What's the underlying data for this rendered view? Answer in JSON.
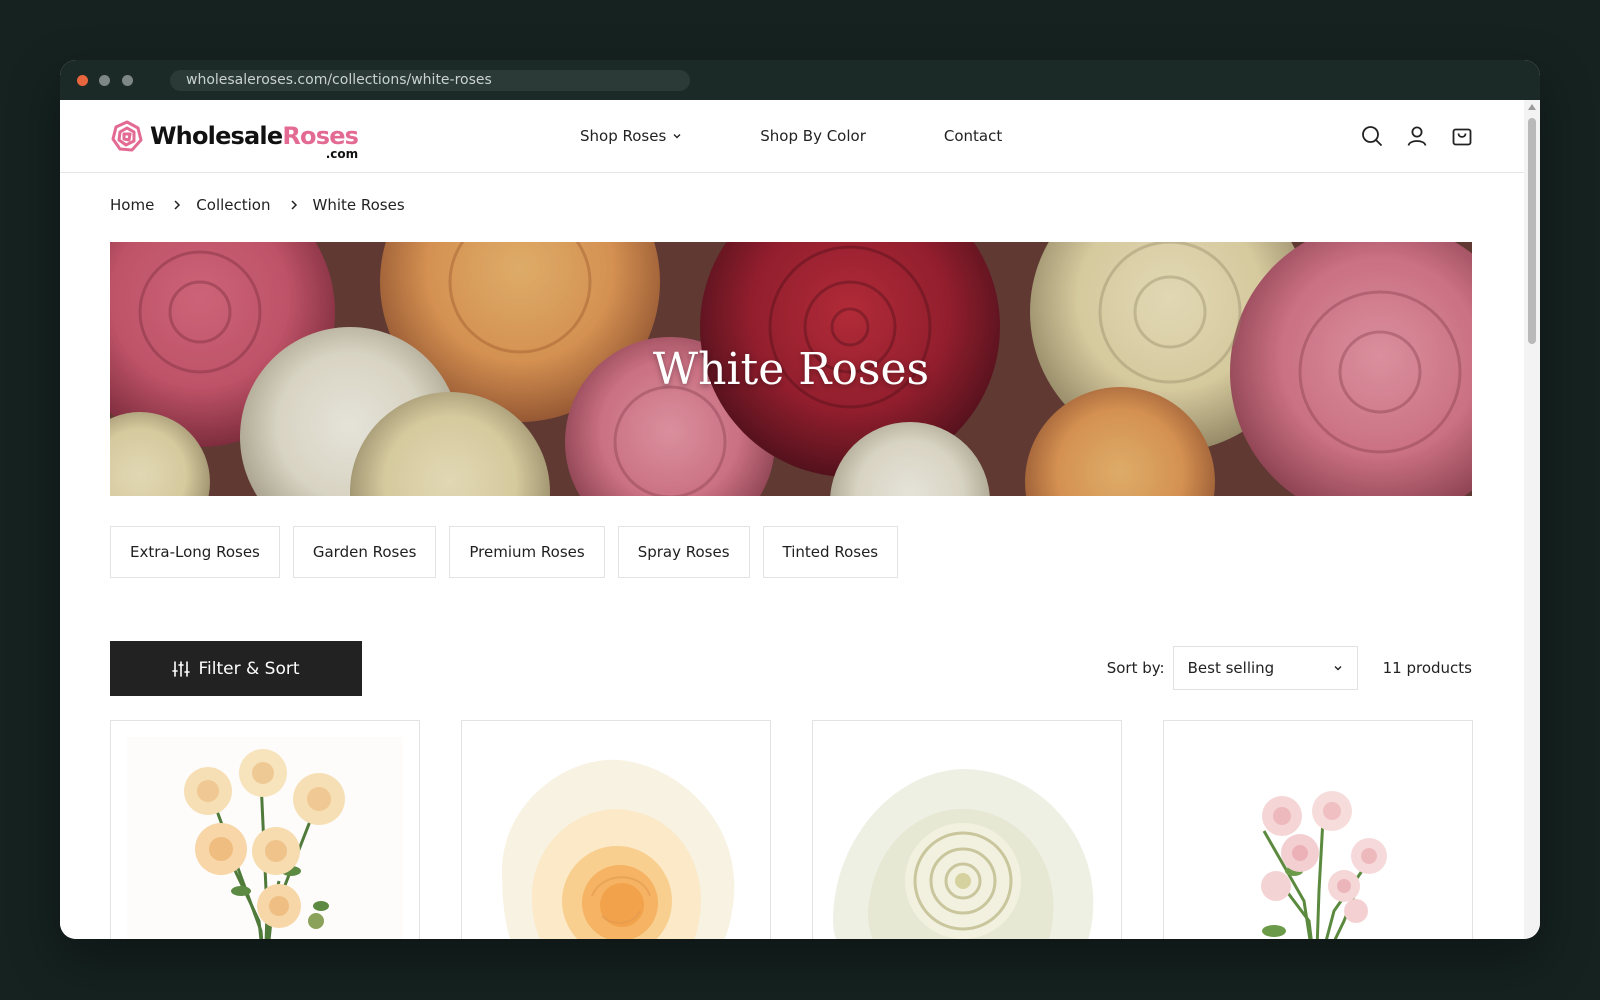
{
  "browser": {
    "url": "wholesaleroses.com/collections/white-roses"
  },
  "logo": {
    "brand_primary": "Wholesale",
    "brand_accent": "Roses",
    "brand_suffix": ".com",
    "accent_color": "#e36a93"
  },
  "nav": {
    "items": [
      {
        "label": "Shop Roses",
        "has_dropdown": true
      },
      {
        "label": "Shop By Color",
        "has_dropdown": false
      },
      {
        "label": "Contact",
        "has_dropdown": false
      }
    ],
    "icons": [
      "search-icon",
      "account-icon",
      "cart-icon"
    ]
  },
  "breadcrumb": {
    "items": [
      "Home",
      "Collection",
      "White Roses"
    ]
  },
  "hero": {
    "title": "White Roses"
  },
  "categories": [
    "Extra-Long Roses",
    "Garden Roses",
    "Premium Roses",
    "Spray Roses",
    "Tinted Roses"
  ],
  "toolbar": {
    "filter_label": "Filter & Sort",
    "sort_label": "Sort by:",
    "sort_value": "Best selling",
    "product_count": "11 products"
  },
  "products": [
    {
      "image": "peach-spray-roses"
    },
    {
      "image": "white-rose-with-peach-center"
    },
    {
      "image": "white-rose"
    },
    {
      "image": "pale-pink-spray-roses"
    }
  ]
}
